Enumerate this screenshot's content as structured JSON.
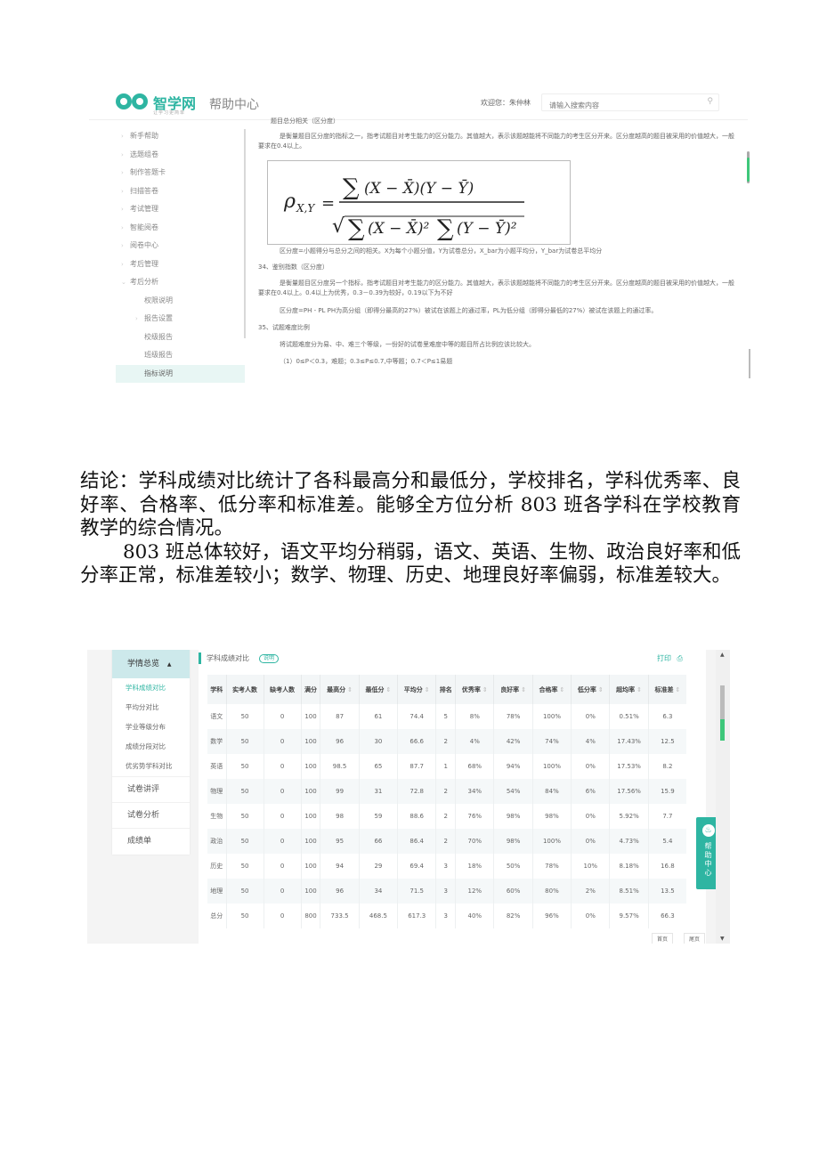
{
  "help_page": {
    "brand": "智学网",
    "brand_sub": "让学习更简单",
    "section_title": "帮助中心",
    "welcome": "欢迎您：朱仲林",
    "search_placeholder": "请输入搜索内容",
    "sidebar": [
      {
        "label": "新手帮助",
        "level": 0,
        "chev": "›"
      },
      {
        "label": "选题组卷",
        "level": 0,
        "chev": "›"
      },
      {
        "label": "制作答题卡",
        "level": 0,
        "chev": "›"
      },
      {
        "label": "扫描答卷",
        "level": 0,
        "chev": "›"
      },
      {
        "label": "考试管理",
        "level": 0,
        "chev": "›"
      },
      {
        "label": "智能阅卷",
        "level": 0,
        "chev": "›"
      },
      {
        "label": "阅卷中心",
        "level": 0,
        "chev": "›"
      },
      {
        "label": "考后管理",
        "level": 0,
        "chev": "›"
      },
      {
        "label": "考后分析",
        "level": 0,
        "chev": "⌄"
      },
      {
        "label": "权限说明",
        "level": 1,
        "chev": ""
      },
      {
        "label": "报告设置",
        "level": 1,
        "chev": "›"
      },
      {
        "label": "校级报告",
        "level": 1,
        "chev": ""
      },
      {
        "label": "班级报告",
        "level": 1,
        "chev": ""
      },
      {
        "label": "指标说明",
        "level": 1,
        "chev": "",
        "active": true
      }
    ],
    "content": {
      "heading_top": "题目总分相关（区分度）",
      "para1": "是衡量题目区分度的指标之一，指考试题目对考生能力的区分能力。其值越大，表示该题越能将不同能力的考生区分开来。区分度越高的题目被采用的价值越大，一般要求在0.4以上。",
      "formula_label": "ρX,Y = Σ(X − X̄)(Y − Ȳ) / √(Σ(X − X̄)² Σ(Y − Ȳ)²)",
      "formula_note": "区分度=小题得分与总分之间的相关。X为每个小题分值，Y为试卷总分，X_bar为小题平均分，Y_bar为试卷总平均分",
      "heading_34": "34、鉴别指数（区分度）",
      "para34": "是衡量题目区分度另一个指标，指考试题目对考生能力的区分能力。其值越大，表示该题越能将不同能力的考生区分开来。区分度越高的题目被采用的价值越大，一般要求在0.4以上。0.4以上为优秀，0.3－0.39为较好，0.19以下为不好",
      "para34b": "区分度=PH - PL  PH为高分组（即得分最高的27%）被试在该题上的通过率，PL为低分组（即得分最低的27%）被试在该题上的通过率。",
      "heading_35": "35、试题难度比例",
      "para35": "将试题难度分为易、中、难三个等级，一份好的试卷里难度中等的题目所占比例应该比较大。",
      "para35b": "（1）0≤P＜0.3，难题；0.3≤P≤0.7,中等题；0.7＜P≤1易题"
    }
  },
  "conclusion": {
    "p1": "结论：学科成绩对比统计了各科最高分和最低分，学校排名，学科优秀率、良好率、合格率、低分率和标准差。能够全方位分析 803 班各学科在学校教育教学的综合情况。",
    "p2": "803 班总体较好，语文平均分稍弱，语文、英语、生物、政治良好率和低分率正常，标准差较小；数学、物理、历史、地理良好率偏弱，标准差较大。"
  },
  "report_page": {
    "nav": {
      "group": "学情总览",
      "group_icon": "▲",
      "subs": [
        "学科成绩对比",
        "平均分对比",
        "学业等级分布",
        "成绩分段对比",
        "优劣势学科对比"
      ],
      "active_sub": 0,
      "mains": [
        "试卷讲评",
        "试卷分析",
        "成绩单"
      ]
    },
    "panel_title": "学科成绩对比",
    "explain": "说明",
    "print": "打印",
    "help_center": "帮助中心",
    "pager": [
      "首页",
      "尾页"
    ],
    "table": {
      "headers": [
        {
          "label": "学科",
          "sort": false
        },
        {
          "label": "实考人数",
          "sort": false
        },
        {
          "label": "缺考人数",
          "sort": false
        },
        {
          "label": "满分",
          "sort": false
        },
        {
          "label": "最高分",
          "sort": true
        },
        {
          "label": "最低分",
          "sort": true
        },
        {
          "label": "平均分",
          "sort": true
        },
        {
          "label": "排名",
          "sort": false
        },
        {
          "label": "优秀率",
          "sort": true
        },
        {
          "label": "良好率",
          "sort": true
        },
        {
          "label": "合格率",
          "sort": true
        },
        {
          "label": "低分率",
          "sort": true
        },
        {
          "label": "超均率",
          "sort": true
        },
        {
          "label": "标准差",
          "sort": true
        }
      ],
      "rows": [
        [
          "语文",
          "50",
          "0",
          "100",
          "87",
          "61",
          "74.4",
          "5",
          "8%",
          "78%",
          "100%",
          "0%",
          "0.51%",
          "6.3"
        ],
        [
          "数学",
          "50",
          "0",
          "100",
          "96",
          "30",
          "66.6",
          "2",
          "4%",
          "42%",
          "74%",
          "4%",
          "17.43%",
          "12.5"
        ],
        [
          "英语",
          "50",
          "0",
          "100",
          "98.5",
          "65",
          "87.7",
          "1",
          "68%",
          "94%",
          "100%",
          "0%",
          "17.53%",
          "8.2"
        ],
        [
          "物理",
          "50",
          "0",
          "100",
          "99",
          "31",
          "72.8",
          "2",
          "34%",
          "54%",
          "84%",
          "6%",
          "17.56%",
          "15.9"
        ],
        [
          "生物",
          "50",
          "0",
          "100",
          "98",
          "59",
          "88.6",
          "2",
          "76%",
          "98%",
          "98%",
          "0%",
          "5.92%",
          "7.7"
        ],
        [
          "政治",
          "50",
          "0",
          "100",
          "95",
          "66",
          "86.4",
          "2",
          "70%",
          "98%",
          "100%",
          "0%",
          "4.73%",
          "5.4"
        ],
        [
          "历史",
          "50",
          "0",
          "100",
          "94",
          "29",
          "69.4",
          "3",
          "18%",
          "50%",
          "78%",
          "10%",
          "8.18%",
          "16.8"
        ],
        [
          "地理",
          "50",
          "0",
          "100",
          "96",
          "34",
          "71.5",
          "3",
          "12%",
          "60%",
          "80%",
          "2%",
          "8.51%",
          "13.5"
        ],
        [
          "总分",
          "50",
          "0",
          "800",
          "733.5",
          "468.5",
          "617.3",
          "3",
          "40%",
          "82%",
          "96%",
          "0%",
          "9.57%",
          "66.3"
        ]
      ]
    }
  },
  "colors": {
    "accent": "#2eb5a2",
    "scroll_green": "#3ec77a"
  }
}
